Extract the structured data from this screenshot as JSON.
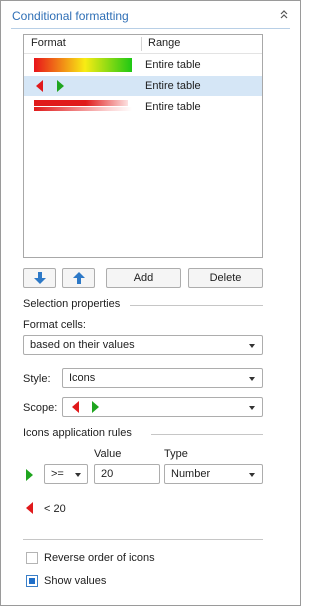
{
  "panel": {
    "title": "Conditional formatting",
    "collapse_icon": "chevron-up-double-icon"
  },
  "rules_list": {
    "columns": [
      "Format",
      "Range"
    ],
    "rows": [
      {
        "format": "color-scale",
        "range": "Entire table",
        "selected": false
      },
      {
        "format": "icon-set",
        "range": "Entire table",
        "selected": true
      },
      {
        "format": "data-bars",
        "range": "Entire table",
        "selected": false
      }
    ]
  },
  "buttons": {
    "move_down_icon": "arrow-down-icon",
    "move_up_icon": "arrow-up-icon",
    "add": "Add",
    "delete": "Delete"
  },
  "selection": {
    "title": "Selection properties",
    "format_cells_label": "Format cells:",
    "format_cells_value": "based on their values",
    "style_label": "Style:",
    "style_value": "Icons",
    "scope_label": "Scope:"
  },
  "icon_rules": {
    "title": "Icons application rules",
    "value_header": "Value",
    "type_header": "Type",
    "rule1": {
      "operator": ">=",
      "value": "20",
      "type": "Number"
    },
    "rule2_text": "< 20"
  },
  "options": {
    "reverse_label": "Reverse order of icons",
    "reverse_checked": false,
    "show_values_label": "Show values",
    "show_values_checked": true
  },
  "colors": {
    "accent": "#2f6fb6",
    "selection": "#d5e6f6",
    "icon_red": "#e0191b",
    "icon_green": "#1fa51f"
  }
}
